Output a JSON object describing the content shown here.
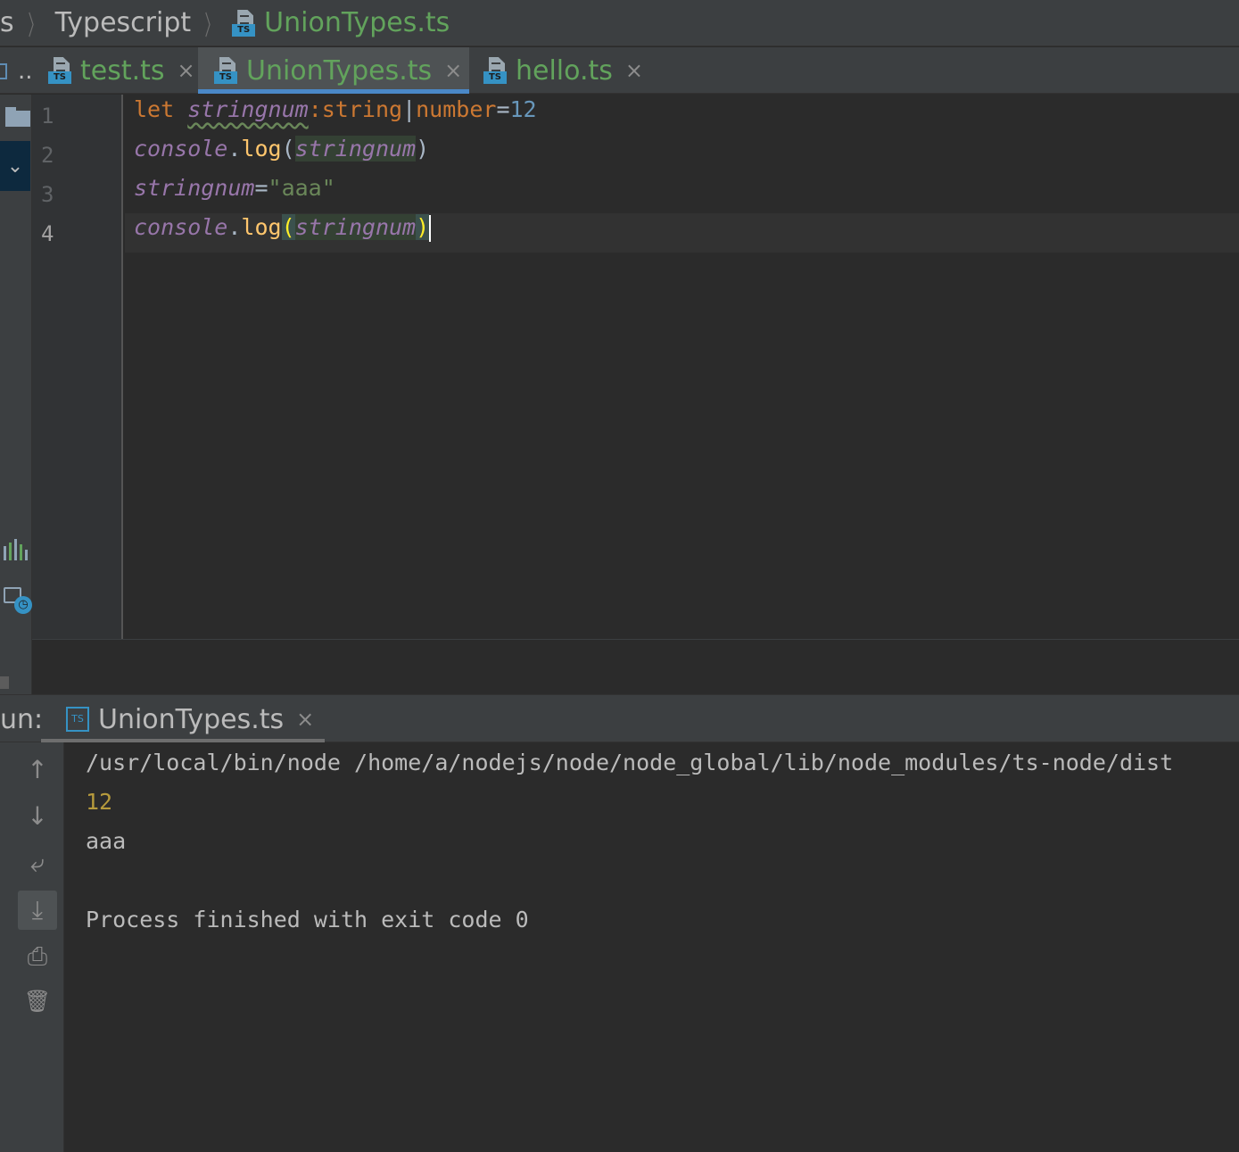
{
  "breadcrumb": {
    "project": "s",
    "folder": "Typescript",
    "file": "UnionTypes.ts",
    "file_badge": "TS"
  },
  "tabs": [
    {
      "label": "test.ts",
      "badge": "TS",
      "active": false
    },
    {
      "label": "UnionTypes.ts",
      "badge": "TS",
      "active": true
    },
    {
      "label": "hello.ts",
      "badge": "TS",
      "active": false
    }
  ],
  "tab_overflow": "..",
  "editor": {
    "line_numbers": [
      "1",
      "2",
      "3",
      "4"
    ],
    "code": {
      "l1": {
        "kw": "let",
        "var": "stringnum",
        "colon": ":",
        "t1": "string",
        "pipe": "|",
        "t2": "number",
        "eq": "=",
        "num": "12"
      },
      "l2": {
        "obj": "console",
        "dot": ".",
        "fn": "log",
        "open": "(",
        "arg": "stringnum",
        "close": ")"
      },
      "l3": {
        "var": "stringnum",
        "eq": "=",
        "str": "\"aaa\""
      },
      "l4": {
        "obj": "console",
        "dot": ".",
        "fn": "log",
        "open": "(",
        "arg": "stringnum",
        "close": ")"
      }
    }
  },
  "run_panel": {
    "label": "un:",
    "tab_label": "UnionTypes.ts",
    "tab_badge": "TS",
    "console_lines": [
      "/usr/local/bin/node /home/a/nodejs/node/node_global/lib/node_modules/ts-node/dist",
      "12",
      "aaa",
      "Process finished with exit code 0"
    ]
  },
  "icons": {
    "close": "×",
    "chevron": "⌄",
    "up": "↑",
    "down": "↓",
    "wrap": "⤶",
    "scroll_end": "⤓",
    "print": "⎙",
    "trash": "🗑"
  },
  "colors": {
    "keyword": "#cc7832",
    "variable": "#9876aa",
    "number": "#6897bb",
    "string": "#6a8759",
    "file_name": "#62a35c",
    "accent": "#4a88c7"
  }
}
